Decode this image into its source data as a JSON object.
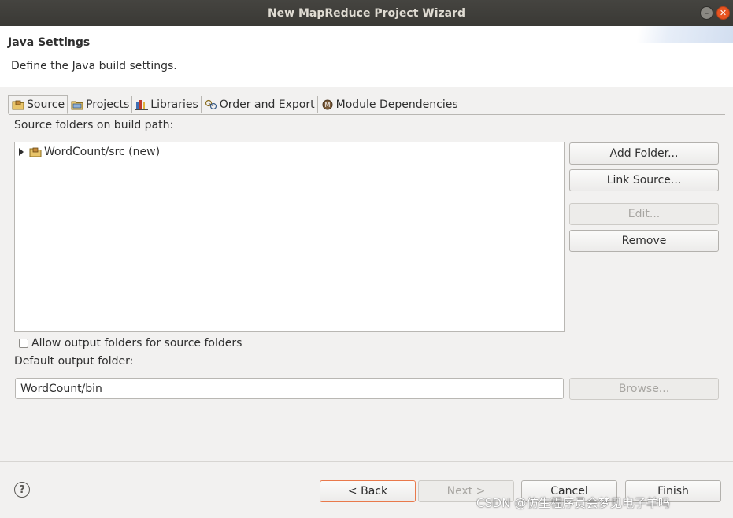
{
  "window": {
    "title": "New MapReduce Project Wizard"
  },
  "header": {
    "title": "Java Settings",
    "description": "Define the Java build settings."
  },
  "tabs": [
    {
      "label": "Source",
      "icon": "source-folder-icon",
      "active": true
    },
    {
      "label": "Projects",
      "icon": "projects-icon",
      "active": false
    },
    {
      "label": "Libraries",
      "icon": "libraries-icon",
      "active": false
    },
    {
      "label": "Order and Export",
      "icon": "order-export-icon",
      "active": false
    },
    {
      "label": "Module Dependencies",
      "icon": "module-icon",
      "active": false
    }
  ],
  "source": {
    "folders_label": "Source folders on build path:",
    "tree_items": [
      {
        "label": "WordCount/src (new)",
        "icon": "package-folder-icon"
      }
    ],
    "buttons": {
      "add_folder": "Add Folder...",
      "link_source": "Link Source...",
      "edit": "Edit...",
      "remove": "Remove"
    },
    "allow_output_label": "Allow output folders for source folders",
    "default_output_label": "Default output folder:",
    "default_output_value": "WordCount/bin",
    "browse": "Browse..."
  },
  "footer": {
    "help": "?",
    "back": "< Back",
    "next": "Next >",
    "cancel": "Cancel",
    "finish": "Finish"
  },
  "watermark": "CSDN @仿生程序员会梦见电子羊吗",
  "colors": {
    "titlebar": "#3c3b37",
    "close": "#e95420",
    "focus_border": "#e9794b",
    "background": "#f2f1f0"
  }
}
